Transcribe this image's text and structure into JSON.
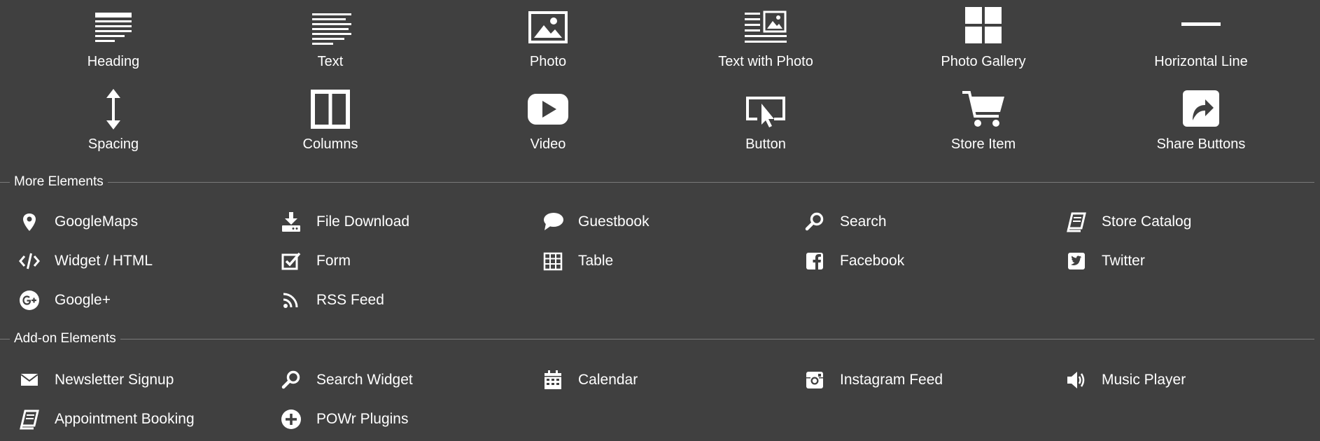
{
  "primary_elements": [
    {
      "label": "Heading",
      "icon": "heading-icon"
    },
    {
      "label": "Text",
      "icon": "text-icon"
    },
    {
      "label": "Photo",
      "icon": "photo-icon"
    },
    {
      "label": "Text with Photo",
      "icon": "text-with-photo-icon"
    },
    {
      "label": "Photo Gallery",
      "icon": "photo-gallery-icon"
    },
    {
      "label": "Horizontal Line",
      "icon": "horizontal-line-icon"
    },
    {
      "label": "Spacing",
      "icon": "spacing-icon"
    },
    {
      "label": "Columns",
      "icon": "columns-icon"
    },
    {
      "label": "Video",
      "icon": "video-icon"
    },
    {
      "label": "Button",
      "icon": "button-icon"
    },
    {
      "label": "Store Item",
      "icon": "cart-icon"
    },
    {
      "label": "Share Buttons",
      "icon": "share-icon"
    }
  ],
  "more_elements": {
    "title": "More Elements",
    "items": [
      {
        "label": "GoogleMaps",
        "icon": "map-pin-icon"
      },
      {
        "label": "File Download",
        "icon": "download-icon"
      },
      {
        "label": "Guestbook",
        "icon": "speech-bubble-icon"
      },
      {
        "label": "Search",
        "icon": "search-icon"
      },
      {
        "label": "Store Catalog",
        "icon": "book-icon"
      },
      {
        "label": "Widget / HTML",
        "icon": "code-icon"
      },
      {
        "label": "Form",
        "icon": "checkbox-icon"
      },
      {
        "label": "Table",
        "icon": "table-icon"
      },
      {
        "label": "Facebook",
        "icon": "facebook-icon"
      },
      {
        "label": "Twitter",
        "icon": "twitter-icon"
      },
      {
        "label": "Google+",
        "icon": "google-plus-icon"
      },
      {
        "label": "RSS Feed",
        "icon": "rss-icon"
      }
    ]
  },
  "addon_elements": {
    "title": "Add-on Elements",
    "items": [
      {
        "label": "Newsletter Signup",
        "icon": "envelope-icon"
      },
      {
        "label": "Search Widget",
        "icon": "search-icon"
      },
      {
        "label": "Calendar",
        "icon": "calendar-icon"
      },
      {
        "label": "Instagram Feed",
        "icon": "instagram-icon"
      },
      {
        "label": "Music Player",
        "icon": "speaker-icon"
      },
      {
        "label": "Appointment Booking",
        "icon": "book-icon"
      },
      {
        "label": "POWr Plugins",
        "icon": "plus-circle-icon"
      }
    ]
  },
  "colors": {
    "background": "#404040",
    "foreground": "#ffffff",
    "divider": "#7a7a7a"
  }
}
